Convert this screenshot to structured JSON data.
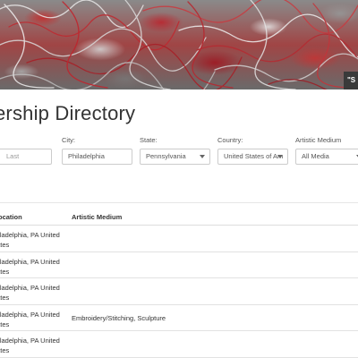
{
  "hero": {
    "caption": "\"S"
  },
  "page": {
    "title": "ership Directory"
  },
  "filters": {
    "last_name": {
      "label": "",
      "placeholder": "Last"
    },
    "city": {
      "label": "City:",
      "value": "Philadelphia"
    },
    "state": {
      "label": "State:",
      "value": "Pennsylvania"
    },
    "country": {
      "label": "Country:",
      "value": "United States of Am"
    },
    "medium": {
      "label": "Artistic Medium",
      "value": "All Media"
    }
  },
  "table": {
    "headers": {
      "location": "ocation",
      "medium": "Artistic Medium"
    },
    "rows": [
      {
        "location": "hiladelphia, PA United\ntates",
        "medium": ""
      },
      {
        "location": "hiladelphia, PA United\ntates",
        "medium": ""
      },
      {
        "location": "hiladelphia, PA United\ntates",
        "medium": ""
      },
      {
        "location": "hiladelphia, PA United\ntates",
        "medium": "Embroidery/Stitching, Sculpture"
      },
      {
        "location": "hiladelphia, PA United\ntates",
        "medium": ""
      }
    ]
  },
  "icons": {
    "select_chevron": "chevron-down-icon"
  },
  "colors": {
    "hero_red": "#b83035",
    "hero_gray": "#9a9a9a",
    "caption_bg": "#3a3a3a",
    "border": "#cccccc"
  }
}
